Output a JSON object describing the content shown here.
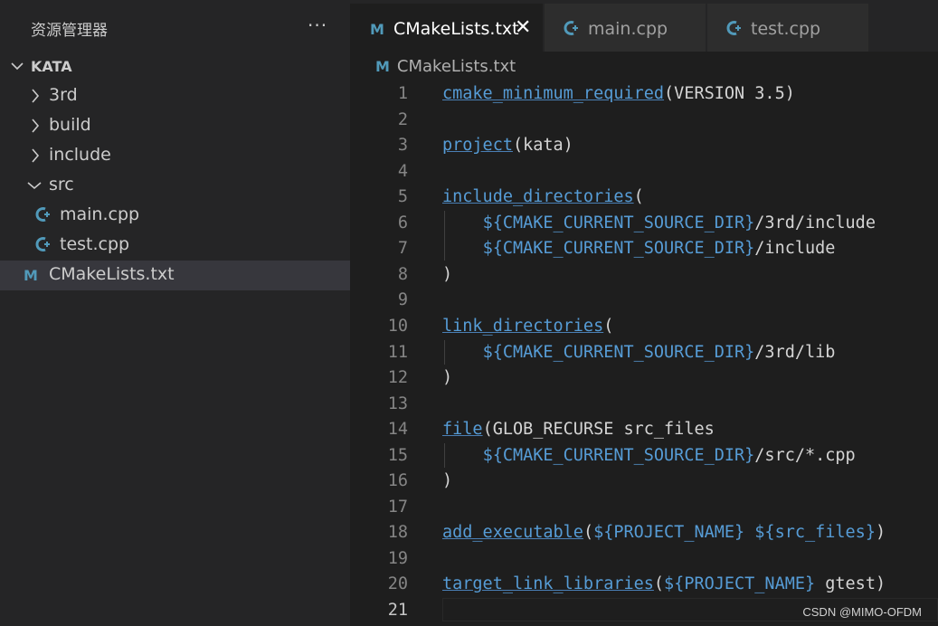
{
  "explorer": {
    "title": "资源管理器",
    "more": "···",
    "root": "KATA",
    "items": [
      {
        "label": "3rd",
        "kind": "folder",
        "state": "collapsed"
      },
      {
        "label": "build",
        "kind": "folder",
        "state": "collapsed"
      },
      {
        "label": "include",
        "kind": "folder",
        "state": "collapsed"
      },
      {
        "label": "src",
        "kind": "folder",
        "state": "expanded"
      },
      {
        "label": "main.cpp",
        "kind": "cpp"
      },
      {
        "label": "test.cpp",
        "kind": "cpp"
      },
      {
        "label": "CMakeLists.txt",
        "kind": "cmake",
        "selected": true
      }
    ]
  },
  "tabs": [
    {
      "label": "CMakeLists.txt",
      "icon": "M",
      "active": true
    },
    {
      "label": "main.cpp",
      "icon": "cpp"
    },
    {
      "label": "test.cpp",
      "icon": "cpp"
    }
  ],
  "breadcrumb": "CMakeLists.txt",
  "code": [
    {
      "n": "1",
      "t": "cmake_minimum_required(VERSION 3.5)"
    },
    {
      "n": "2",
      "t": ""
    },
    {
      "n": "3",
      "t": "project(kata)"
    },
    {
      "n": "4",
      "t": ""
    },
    {
      "n": "5",
      "t": "include_directories("
    },
    {
      "n": "6",
      "t": "    ${CMAKE_CURRENT_SOURCE_DIR}/3rd/include"
    },
    {
      "n": "7",
      "t": "    ${CMAKE_CURRENT_SOURCE_DIR}/include"
    },
    {
      "n": "8",
      "t": ")"
    },
    {
      "n": "9",
      "t": ""
    },
    {
      "n": "10",
      "t": "link_directories("
    },
    {
      "n": "11",
      "t": "    ${CMAKE_CURRENT_SOURCE_DIR}/3rd/lib"
    },
    {
      "n": "12",
      "t": ")"
    },
    {
      "n": "13",
      "t": ""
    },
    {
      "n": "14",
      "t": "file(GLOB_RECURSE src_files"
    },
    {
      "n": "15",
      "t": "    ${CMAKE_CURRENT_SOURCE_DIR}/src/*.cpp"
    },
    {
      "n": "16",
      "t": ")"
    },
    {
      "n": "17",
      "t": ""
    },
    {
      "n": "18",
      "t": "add_executable(${PROJECT_NAME} ${src_files})"
    },
    {
      "n": "19",
      "t": ""
    },
    {
      "n": "20",
      "t": "target_link_libraries(${PROJECT_NAME} gtest)"
    },
    {
      "n": "21",
      "t": "",
      "current": true
    }
  ],
  "watermark": "CSDN @MIMO-OFDM",
  "colors": {
    "keyword": "#569cd6",
    "text": "#d4d4d4",
    "cmake_icon": "#519aba",
    "cpp_icon": "#519aba"
  }
}
